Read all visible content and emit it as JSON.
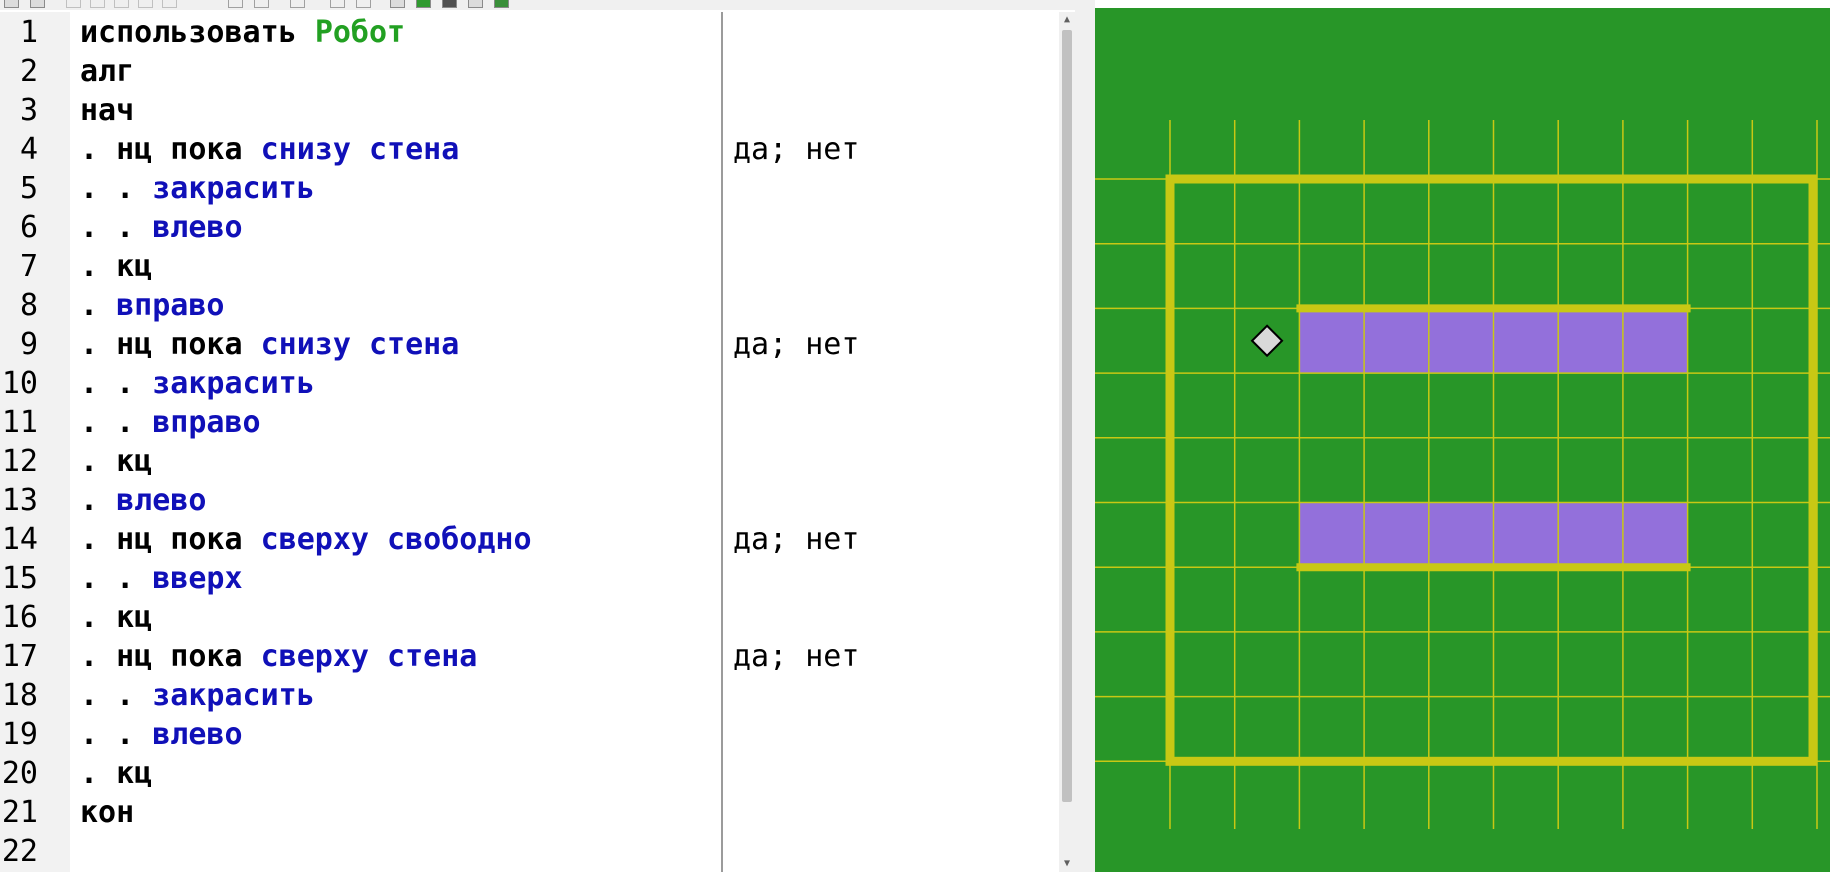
{
  "editor": {
    "lines": [
      {
        "n": "1",
        "indent": "",
        "tokens": [
          {
            "t": "использовать",
            "c": "kw"
          },
          {
            "t": " ",
            "c": "kw"
          },
          {
            "t": "Робот",
            "c": "mod"
          }
        ],
        "margin": ""
      },
      {
        "n": "2",
        "indent": "",
        "tokens": [
          {
            "t": "алг",
            "c": "kw"
          }
        ],
        "margin": ""
      },
      {
        "n": "3",
        "indent": "",
        "tokens": [
          {
            "t": "нач",
            "c": "kw"
          }
        ],
        "margin": ""
      },
      {
        "n": "4",
        "indent": ". ",
        "tokens": [
          {
            "t": "нц пока",
            "c": "kw"
          },
          {
            "t": " ",
            "c": "kw"
          },
          {
            "t": "снизу стена",
            "c": "cmd"
          }
        ],
        "margin": "да; нет"
      },
      {
        "n": "5",
        "indent": ". . ",
        "tokens": [
          {
            "t": "закрасить",
            "c": "cmd"
          }
        ],
        "margin": ""
      },
      {
        "n": "6",
        "indent": ". . ",
        "tokens": [
          {
            "t": "влево",
            "c": "cmd"
          }
        ],
        "margin": ""
      },
      {
        "n": "7",
        "indent": ". ",
        "tokens": [
          {
            "t": "кц",
            "c": "kw"
          }
        ],
        "margin": ""
      },
      {
        "n": "8",
        "indent": ". ",
        "tokens": [
          {
            "t": "вправо",
            "c": "cmd"
          }
        ],
        "margin": ""
      },
      {
        "n": "9",
        "indent": ". ",
        "tokens": [
          {
            "t": "нц пока",
            "c": "kw"
          },
          {
            "t": " ",
            "c": "kw"
          },
          {
            "t": "снизу стена",
            "c": "cmd"
          }
        ],
        "margin": "да; нет"
      },
      {
        "n": "10",
        "indent": ". . ",
        "tokens": [
          {
            "t": "закрасить",
            "c": "cmd"
          }
        ],
        "margin": ""
      },
      {
        "n": "11",
        "indent": ". . ",
        "tokens": [
          {
            "t": "вправо",
            "c": "cmd"
          }
        ],
        "margin": ""
      },
      {
        "n": "12",
        "indent": ". ",
        "tokens": [
          {
            "t": "кц",
            "c": "kw"
          }
        ],
        "margin": ""
      },
      {
        "n": "13",
        "indent": ". ",
        "tokens": [
          {
            "t": "влево",
            "c": "cmd"
          }
        ],
        "margin": ""
      },
      {
        "n": "14",
        "indent": ". ",
        "tokens": [
          {
            "t": "нц пока",
            "c": "kw"
          },
          {
            "t": " ",
            "c": "kw"
          },
          {
            "t": "сверху свободно",
            "c": "cmd"
          }
        ],
        "margin": "да; нет"
      },
      {
        "n": "15",
        "indent": ". . ",
        "tokens": [
          {
            "t": "вверх",
            "c": "cmd"
          }
        ],
        "margin": ""
      },
      {
        "n": "16",
        "indent": ". ",
        "tokens": [
          {
            "t": "кц",
            "c": "kw"
          }
        ],
        "margin": ""
      },
      {
        "n": "17",
        "indent": ". ",
        "tokens": [
          {
            "t": "нц пока",
            "c": "kw"
          },
          {
            "t": " ",
            "c": "kw"
          },
          {
            "t": "сверху стена",
            "c": "cmd"
          }
        ],
        "margin": "да; нет"
      },
      {
        "n": "18",
        "indent": ". . ",
        "tokens": [
          {
            "t": "закрасить",
            "c": "cmd"
          }
        ],
        "margin": ""
      },
      {
        "n": "19",
        "indent": ". . ",
        "tokens": [
          {
            "t": "влево",
            "c": "cmd"
          }
        ],
        "margin": ""
      },
      {
        "n": "20",
        "indent": ". ",
        "tokens": [
          {
            "t": "кц",
            "c": "kw"
          }
        ],
        "margin": ""
      },
      {
        "n": "21",
        "indent": "",
        "tokens": [
          {
            "t": "кон",
            "c": "kw"
          }
        ],
        "margin": ""
      },
      {
        "n": "22",
        "indent": "",
        "tokens": [],
        "margin": ""
      }
    ]
  },
  "colors": {
    "keyword": "#000000",
    "command": "#1010b8",
    "module": "#22a022",
    "field_background": "#289628",
    "wall": "#c8c814",
    "painted_cell": "#9370db",
    "robot": "#d9d9d9"
  },
  "robot_field": {
    "outer_border_cells": {
      "col_from": 0,
      "col_to": 10,
      "row_from": 0,
      "row_to": 9
    },
    "robot_cell": {
      "col": 1,
      "row": 2
    },
    "painted_cells": [
      {
        "col": 2,
        "row": 2
      },
      {
        "col": 3,
        "row": 2
      },
      {
        "col": 4,
        "row": 2
      },
      {
        "col": 5,
        "row": 2
      },
      {
        "col": 6,
        "row": 2
      },
      {
        "col": 7,
        "row": 2
      },
      {
        "col": 2,
        "row": 5
      },
      {
        "col": 3,
        "row": 5
      },
      {
        "col": 4,
        "row": 5
      },
      {
        "col": 5,
        "row": 5
      },
      {
        "col": 6,
        "row": 5
      },
      {
        "col": 7,
        "row": 5
      }
    ],
    "inner_walls": [
      {
        "side": "top",
        "row": 2,
        "col_from": 2,
        "col_to": 8
      },
      {
        "side": "bottom",
        "row": 5,
        "col_from": 2,
        "col_to": 8
      }
    ]
  }
}
